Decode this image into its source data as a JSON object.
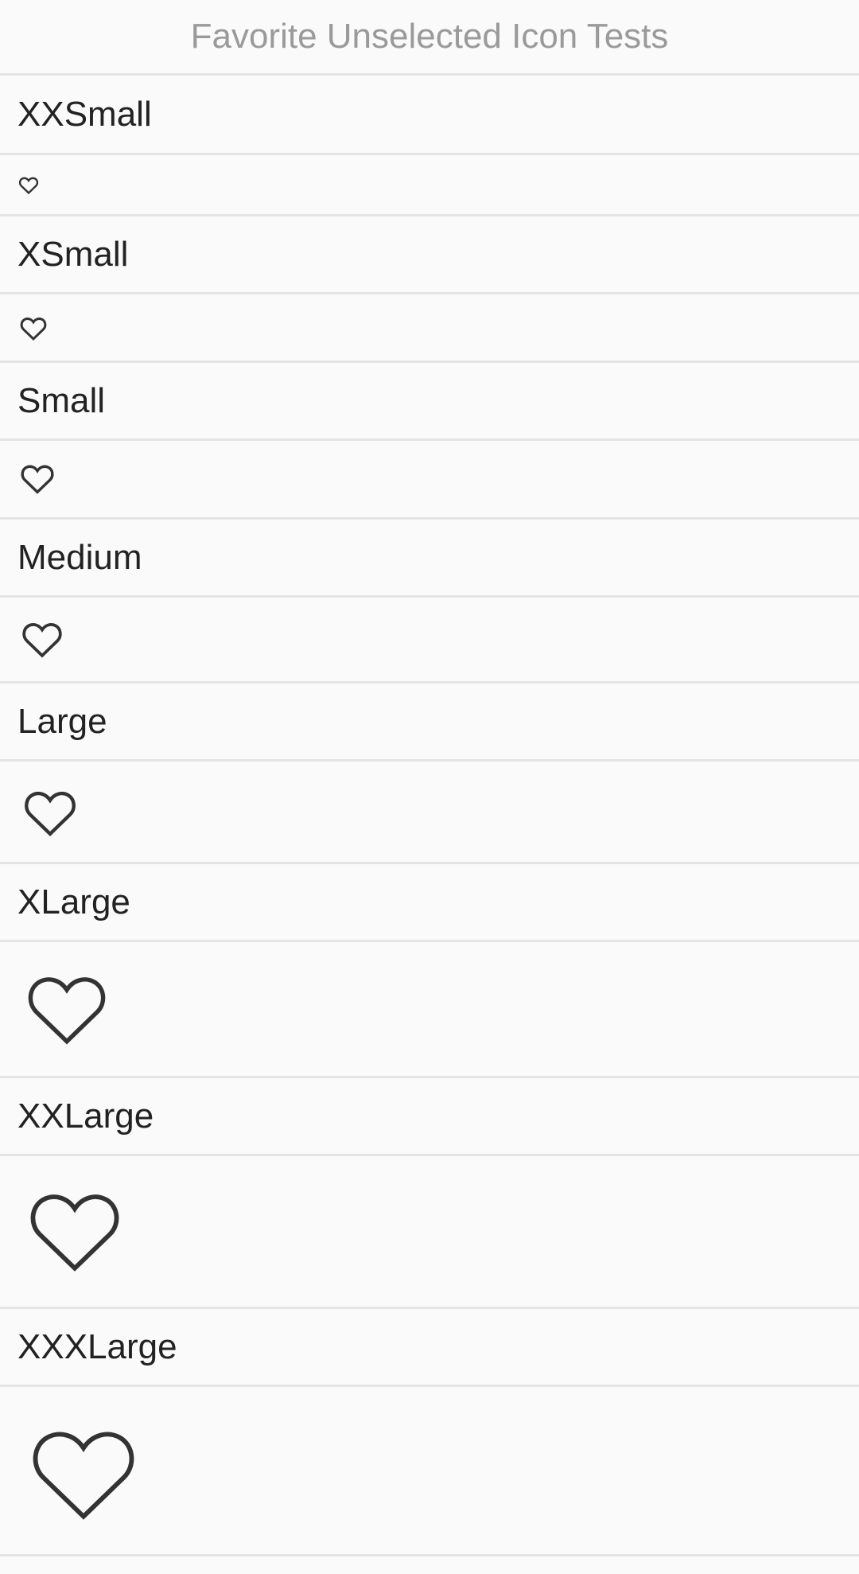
{
  "header": {
    "title": "Favorite Unselected Icon Tests"
  },
  "sections": [
    {
      "label": "XXSmall"
    },
    {
      "label": "XSmall"
    },
    {
      "label": "Small"
    },
    {
      "label": "Medium"
    },
    {
      "label": "Large"
    },
    {
      "label": "XLarge"
    },
    {
      "label": "XXLarge"
    },
    {
      "label": "XXXLarge"
    }
  ],
  "icon": {
    "name": "heart-outline-icon",
    "color": "#333333"
  },
  "colors": {
    "background": "#fafafa",
    "divider": "#e4e4e4",
    "header_text": "#9a9a9a",
    "label_text": "#222222"
  }
}
